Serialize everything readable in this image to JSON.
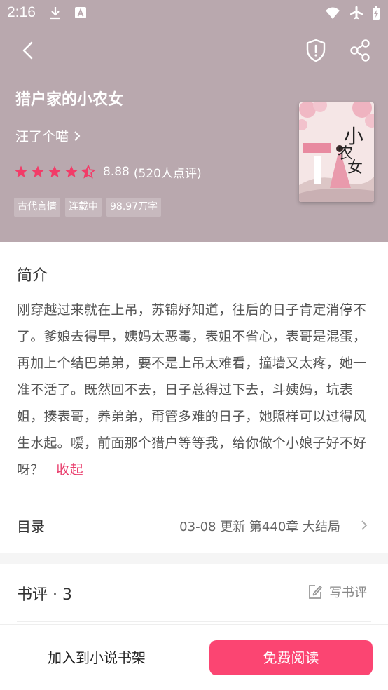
{
  "status_bar": {
    "time": "2:16"
  },
  "book": {
    "title": "猎户家的小农女",
    "author": "汪了个喵",
    "rating_score": "8.88",
    "rating_count": "(520人点评)",
    "rating_stars": 4.5,
    "tags": [
      "古代言情",
      "连载中",
      "98.97万字"
    ]
  },
  "intro": {
    "heading": "简介",
    "text": "刚穿越过来就在上吊，苏锦妤知道，往后的日子肯定消停不了。爹娘去得早，姨妈太恶毒，表姐不省心，表哥是混蛋，再加上个结巴弟弟，要不是上吊太难看，撞墙又太疼，她一准不活了。既然回不去，日子总得过下去，斗姨妈，坑表姐，揍表哥，养弟弟，甭管多难的日子，她照样可以过得风生水起。嗳，前面那个猎户等等我，给你做个小娘子好不好呀？",
    "collapse_label": "收起"
  },
  "toc": {
    "label": "目录",
    "info": "03-08  更新  第440章 大结局"
  },
  "reviews": {
    "title": "书评 · 3",
    "write_label": "写书评"
  },
  "bottom": {
    "shelf_label": "加入到小说书架",
    "read_label": "免费阅读"
  },
  "colors": {
    "header_bg": "#b9a8ae",
    "accent": "#fb4572",
    "star": "#f23c68"
  },
  "icons": {
    "back": "back-arrow-icon",
    "shield": "shield-alert-icon",
    "share": "share-icon",
    "star": "star-icon",
    "chevron": "chevron-right-icon",
    "edit": "edit-icon"
  }
}
